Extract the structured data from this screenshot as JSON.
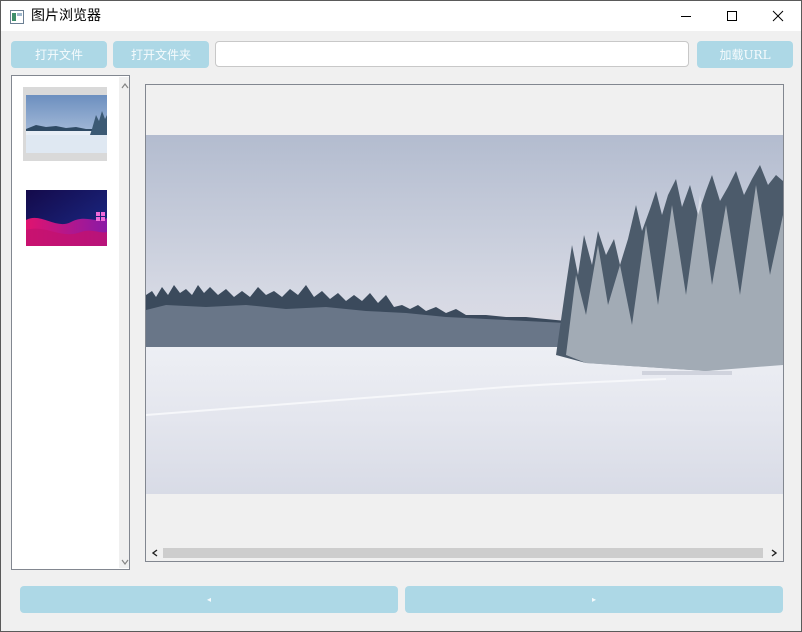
{
  "window": {
    "title": "图片浏览器",
    "controls": {
      "minimize": "minimize-icon",
      "maximize": "maximize-icon",
      "close": "close-icon"
    }
  },
  "toolbar": {
    "open_file_label": "打开文件",
    "open_folder_label": "打开文件夹",
    "url_value": "",
    "load_url_label": "加载URL"
  },
  "navigation": {
    "prev_label": "◂",
    "next_label": "▸"
  },
  "colors": {
    "button": "#add8e6",
    "button_text": "#f6fbfd",
    "background": "#f0f0f0"
  }
}
